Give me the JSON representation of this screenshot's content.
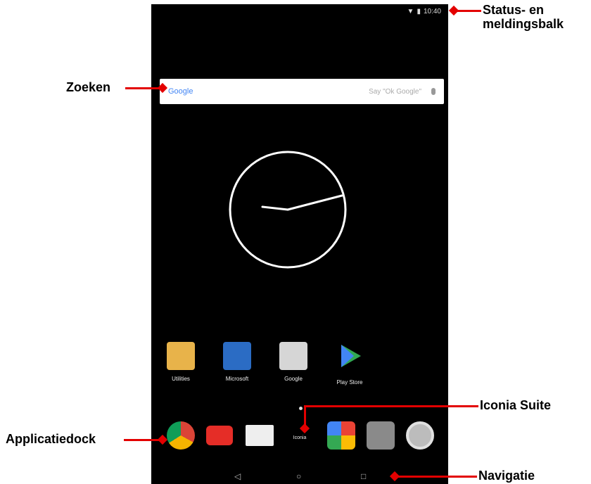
{
  "callouts": {
    "status": "Status- en\nmeldingsbalk",
    "search": "Zoeken",
    "iconia": "Iconia Suite",
    "dock": "Applicatiedock",
    "nav": "Navigatie"
  },
  "status_bar": {
    "time": "10:40"
  },
  "search_bar": {
    "brand": "Google",
    "hint": "Say \"Ok Google\""
  },
  "apps": [
    {
      "label": "Utilities",
      "icon": "folder-icon",
      "color": "#e8b34a"
    },
    {
      "label": "Microsoft",
      "icon": "office-icon",
      "color": "#2b6cc4"
    },
    {
      "label": "Google",
      "icon": "google-folder-icon",
      "color": "#d6d6d6"
    },
    {
      "label": "Play Store",
      "icon": "play-store-icon",
      "color": "#31a853"
    }
  ],
  "dock": {
    "iconia_label": "Iconia",
    "items": [
      "chrome-icon",
      "youtube-icon",
      "gmail-icon",
      "iconia-icon",
      "photos-icon",
      "camera-icon",
      "settings-icon"
    ]
  },
  "navigation": [
    "back-icon",
    "home-icon",
    "recents-icon"
  ]
}
